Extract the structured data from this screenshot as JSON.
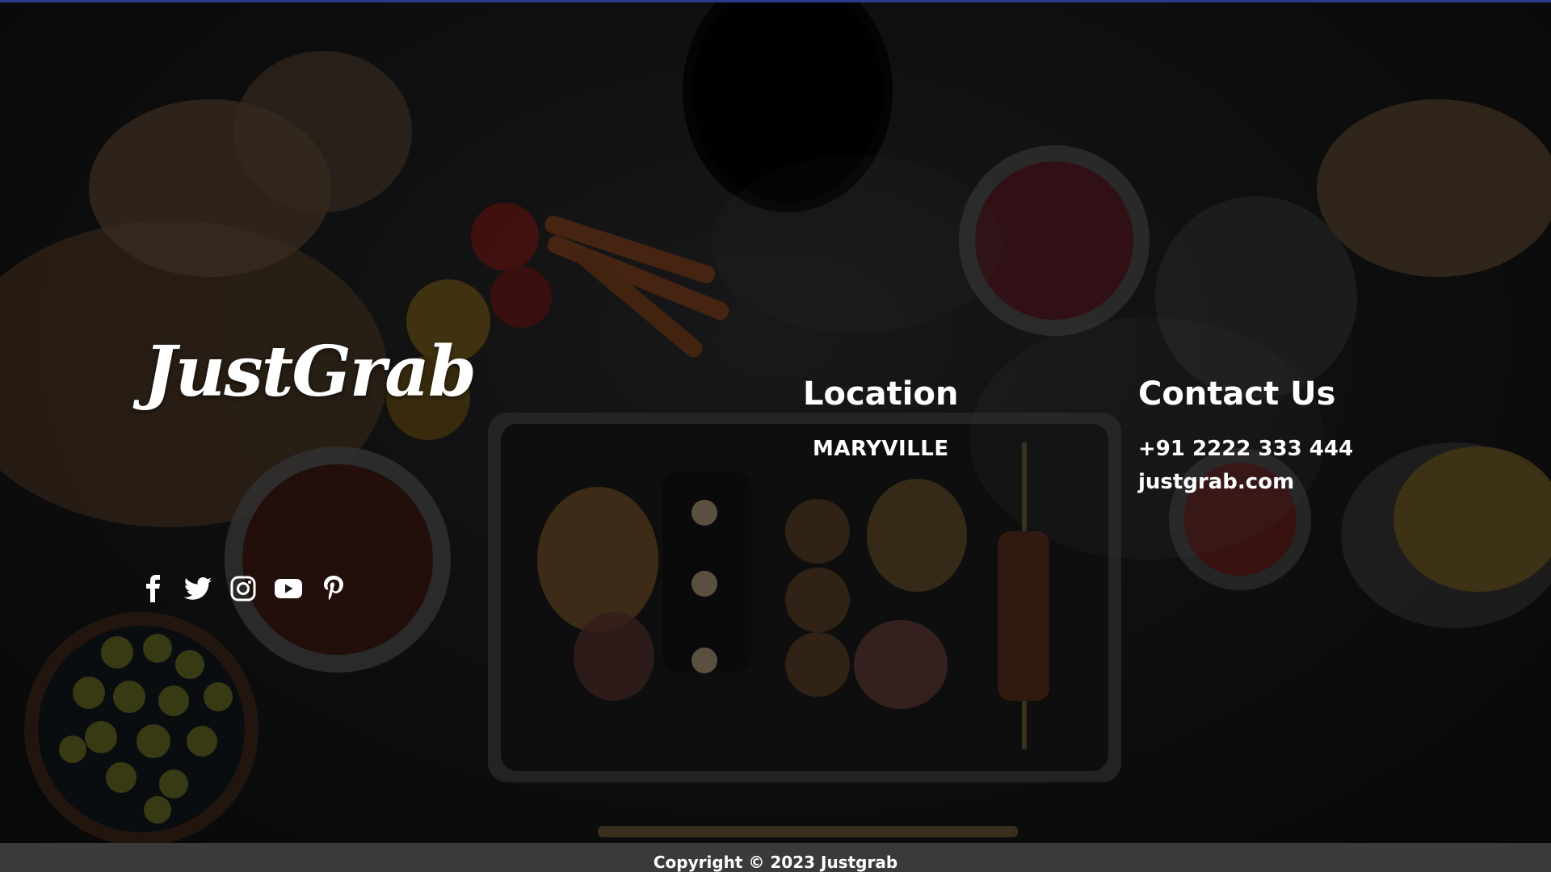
{
  "colors": {
    "top_accent": "#2b3a8c",
    "text": "#ffffff",
    "footer_bg": "#3a3a3a",
    "background": "#161617"
  },
  "brand": {
    "name": "JustGrab"
  },
  "social_links": [
    {
      "name": "facebook",
      "icon": "facebook-icon"
    },
    {
      "name": "twitter",
      "icon": "twitter-icon"
    },
    {
      "name": "instagram",
      "icon": "instagram-icon"
    },
    {
      "name": "youtube",
      "icon": "youtube-icon"
    },
    {
      "name": "pinterest",
      "icon": "pinterest-icon"
    }
  ],
  "location": {
    "heading": "Location",
    "value": "MARYVILLE"
  },
  "contact": {
    "heading": "Contact Us",
    "phone": "+91 2222 333 444",
    "website": "justgrab.com"
  },
  "footer": {
    "copyright": "Copyright © 2023 Justgrab"
  }
}
